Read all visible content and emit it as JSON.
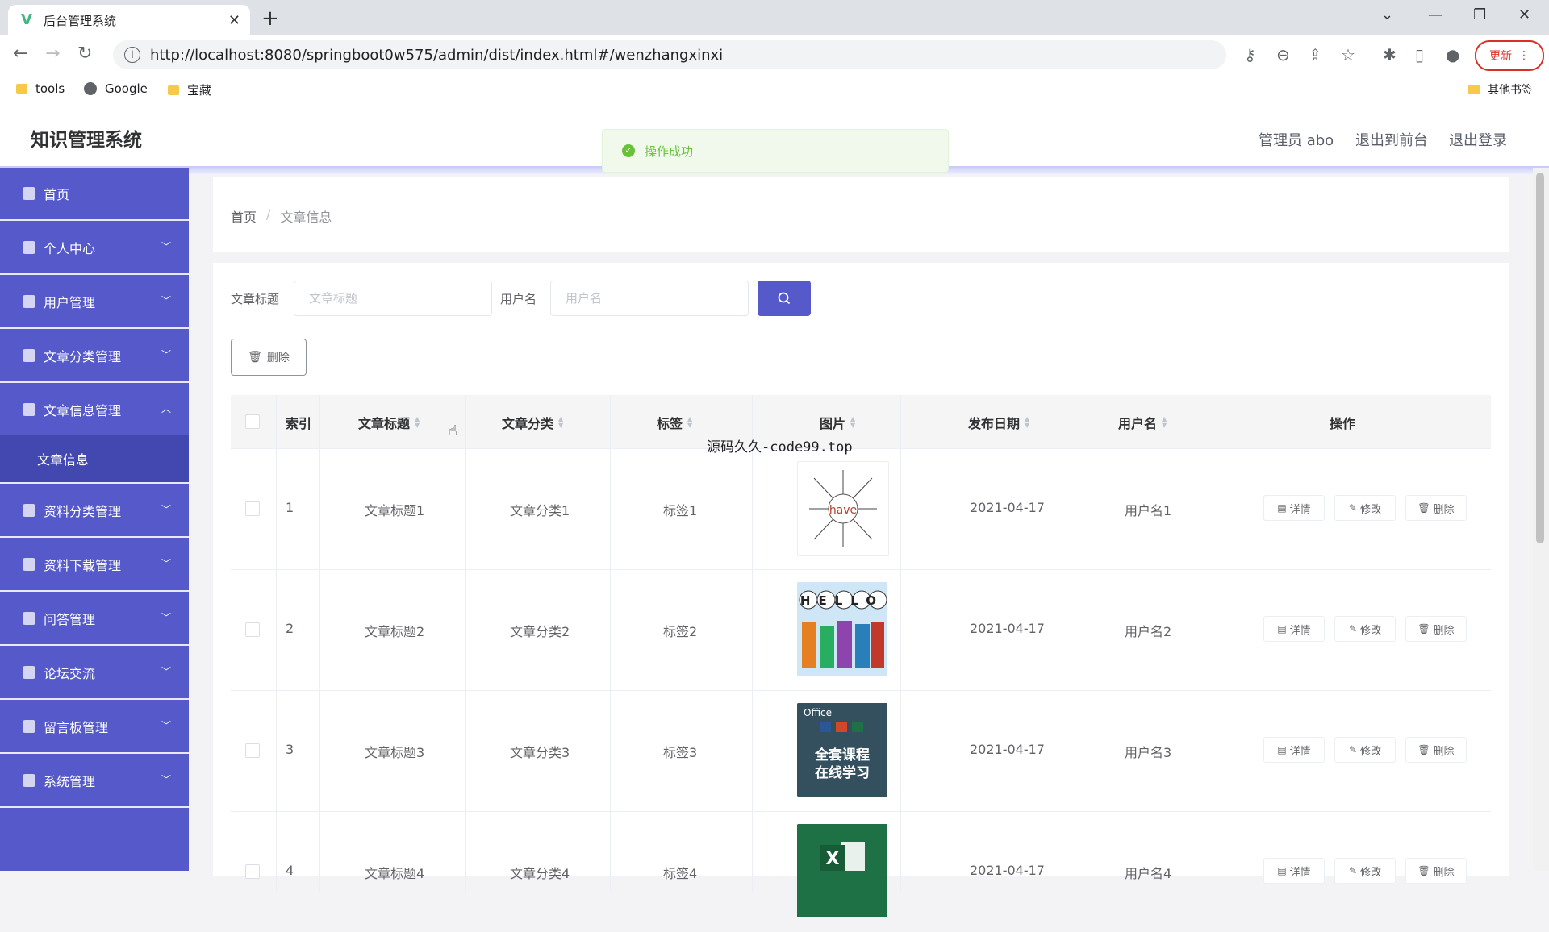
{
  "browser": {
    "tab_title": "后台管理系统",
    "url": "http://localhost:8080/springboot0w575/admin/dist/index.html#/wenzhangxinxi",
    "update_label": "更新",
    "bookmarks": [
      "tools",
      "Google",
      "宝藏"
    ],
    "other_bookmarks": "其他书签"
  },
  "header": {
    "brand": "知识管理系统",
    "admin_label": "管理员 abo",
    "to_front": "退出到前台",
    "logout": "退出登录"
  },
  "toast": {
    "message": "操作成功",
    "color": "#67c23a"
  },
  "sidebar": {
    "accent": "#5559c9",
    "items": [
      {
        "label": "首页",
        "icon": "home-icon"
      },
      {
        "label": "个人中心",
        "icon": "user-icon"
      },
      {
        "label": "用户管理",
        "icon": "send-icon"
      },
      {
        "label": "文章分类管理",
        "icon": "flag-icon"
      },
      {
        "label": "文章信息管理",
        "icon": "doc-icon"
      },
      {
        "label": "资料分类管理",
        "icon": "copy-icon"
      },
      {
        "label": "资料下载管理",
        "icon": "user-icon"
      },
      {
        "label": "问答管理",
        "icon": "edit-icon"
      },
      {
        "label": "论坛交流",
        "icon": "grid-icon"
      },
      {
        "label": "留言板管理",
        "icon": "monitor-icon"
      },
      {
        "label": "系统管理",
        "icon": "pin-icon"
      }
    ],
    "sub_active": "文章信息"
  },
  "breadcrumb": {
    "home": "首页",
    "current": "文章信息"
  },
  "filters": {
    "title_label": "文章标题",
    "title_placeholder": "文章标题",
    "user_label": "用户名",
    "user_placeholder": "用户名"
  },
  "toolbar": {
    "delete_label": "删除"
  },
  "table": {
    "headers": {
      "index": "索引",
      "title": "文章标题",
      "category": "文章分类",
      "tag": "标签",
      "image": "图片",
      "date": "发布日期",
      "user": "用户名",
      "ops": "操作"
    },
    "rows": [
      {
        "index": "1",
        "title": "文章标题1",
        "category": "文章分类1",
        "tag": "标签1",
        "date": "2021-04-17",
        "user": "用户名1"
      },
      {
        "index": "2",
        "title": "文章标题2",
        "category": "文章分类2",
        "tag": "标签2",
        "date": "2021-04-17",
        "user": "用户名2"
      },
      {
        "index": "3",
        "title": "文章标题3",
        "category": "文章分类3",
        "tag": "标签3",
        "date": "2021-04-17",
        "user": "用户名3"
      },
      {
        "index": "4",
        "title": "文章标题4",
        "category": "文章分类4",
        "tag": "标签4",
        "date": "2021-04-17",
        "user": "用户名4"
      }
    ],
    "ops": {
      "detail": "详情",
      "edit": "修改",
      "delete": "删除"
    },
    "thumb_texts": {
      "have": "have",
      "hello": "HELLO",
      "office": "Office",
      "course_line1": "全套课程",
      "course_line2": "在线学习",
      "excel": "X"
    }
  },
  "overlay_text": "源码久久-code99.top"
}
